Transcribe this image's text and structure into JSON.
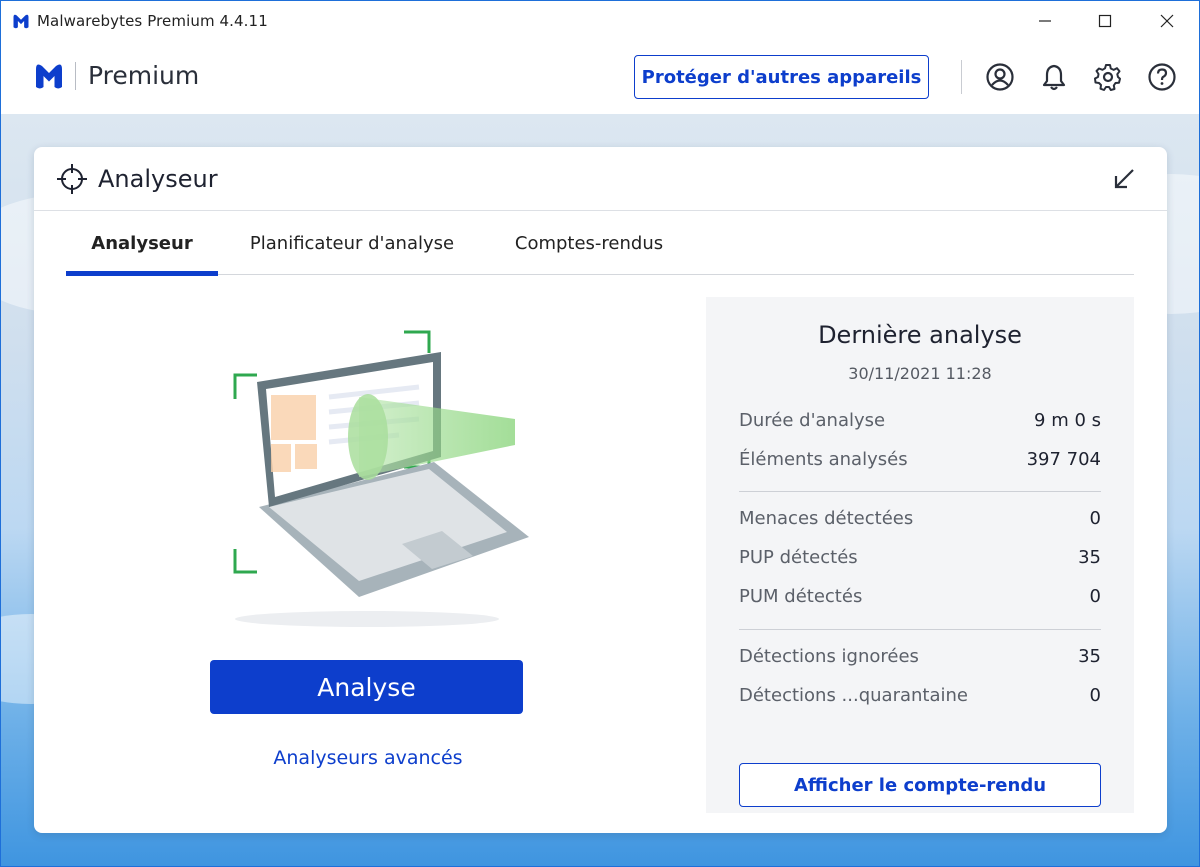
{
  "window": {
    "title": "Malwarebytes Premium  4.4.11"
  },
  "header": {
    "brand": "Premium",
    "protect_button": "Protéger d'autres appareils",
    "icons": [
      "account-icon",
      "bell-icon",
      "gear-icon",
      "help-icon"
    ]
  },
  "card": {
    "title": "Analyseur",
    "tabs": [
      {
        "label": "Analyseur",
        "active": true
      },
      {
        "label": "Planificateur d'analyse",
        "active": false
      },
      {
        "label": "Comptes-rendus",
        "active": false
      }
    ],
    "scan_button": "Analyse",
    "advanced_link": "Analyseurs avancés"
  },
  "last_scan": {
    "title": "Dernière analyse",
    "date": "30/11/2021 11:28",
    "group1": [
      {
        "label": "Durée d'analyse",
        "value": "9 m 0 s"
      },
      {
        "label": "Éléments analysés",
        "value": "397 704"
      }
    ],
    "group2": [
      {
        "label": "Menaces détectées",
        "value": "0"
      },
      {
        "label": "PUP détectés",
        "value": "35"
      },
      {
        "label": "PUM détectés",
        "value": "0"
      }
    ],
    "group3": [
      {
        "label": "Détections ignorées",
        "value": "35"
      },
      {
        "label": "Détections ...quarantaine",
        "value": "0"
      }
    ],
    "report_button": "Afficher le compte-rendu"
  },
  "colors": {
    "accent": "#0d3ecc",
    "window_border": "#1e6fd9",
    "panel_bg": "#f4f5f7"
  }
}
